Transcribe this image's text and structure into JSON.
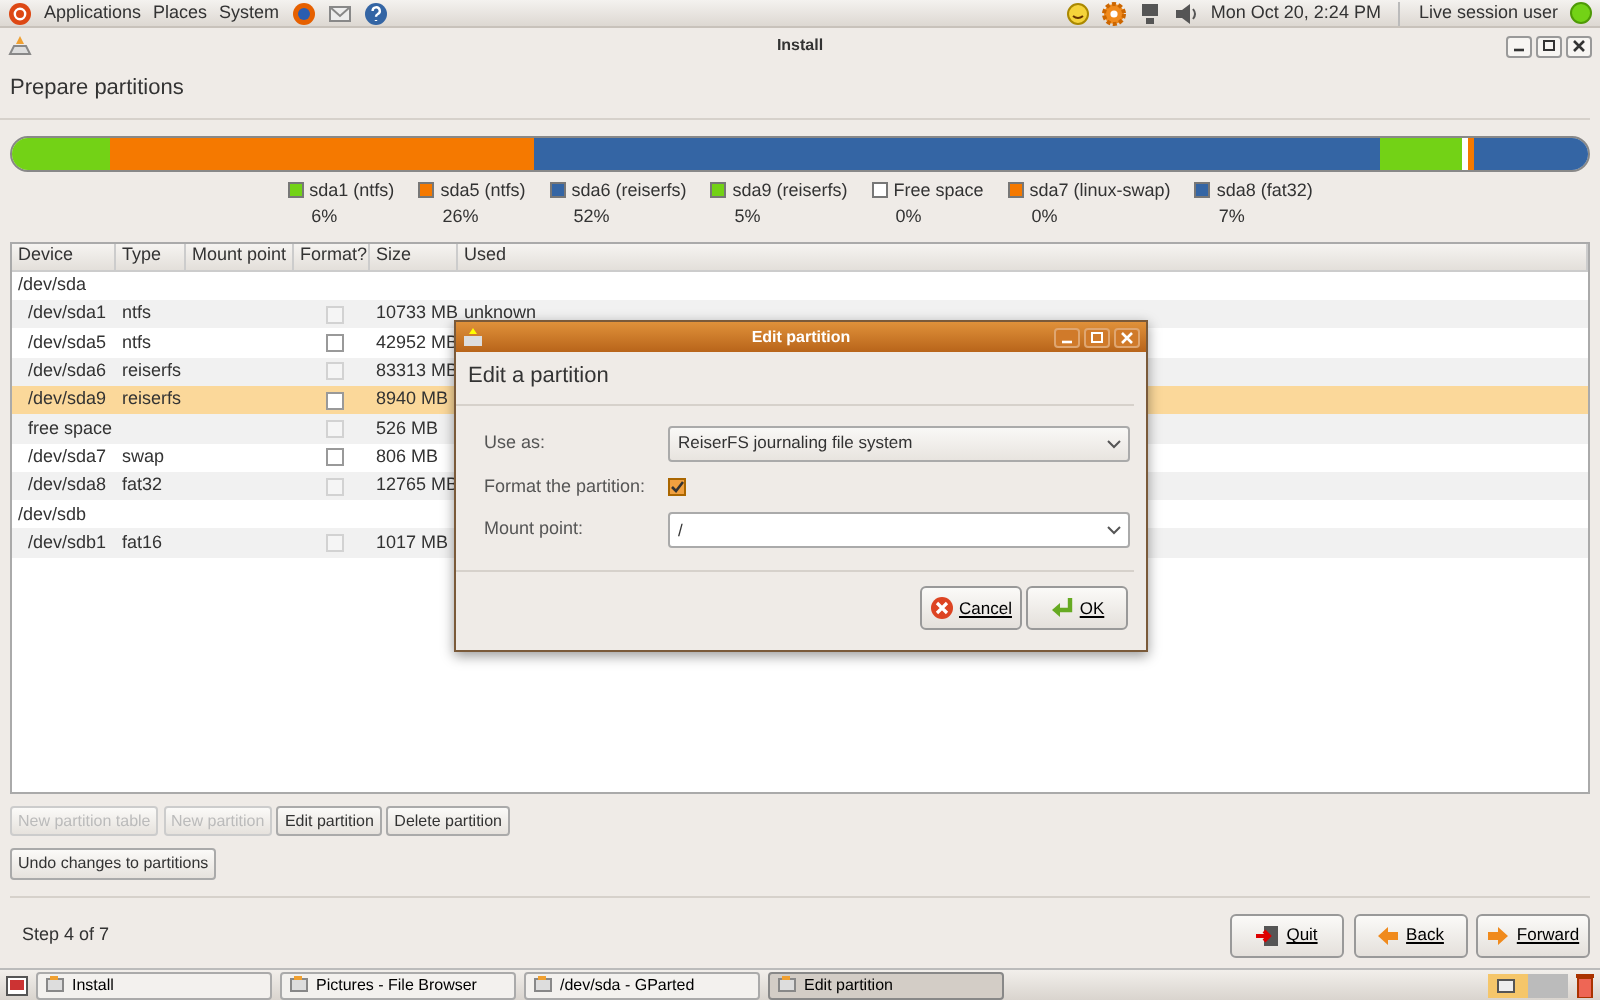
{
  "top_panel": {
    "menus": [
      "Applications",
      "Places",
      "System"
    ],
    "clock": "Mon Oct 20,  2:24 PM",
    "user": "Live session user"
  },
  "window": {
    "title": "Install"
  },
  "page": {
    "heading": "Prepare partitions"
  },
  "partitions": [
    {
      "name": "sda1 (ntfs)",
      "percent": "6%",
      "color": "#73d216"
    },
    {
      "name": "sda5 (ntfs)",
      "percent": "26%",
      "color": "#f57900"
    },
    {
      "name": "sda6 (reiserfs)",
      "percent": "52%",
      "color": "#3465a4"
    },
    {
      "name": "sda9 (reiserfs)",
      "percent": "5%",
      "color": "#73d216"
    },
    {
      "name": "Free space",
      "percent": "0%",
      "color": "#ffffff"
    },
    {
      "name": "sda7 (linux-swap)",
      "percent": "0%",
      "color": "#f57900"
    },
    {
      "name": "sda8 (fat32)",
      "percent": "7%",
      "color": "#3465a4"
    }
  ],
  "table": {
    "columns": [
      "Device",
      "Type",
      "Mount point",
      "Format?",
      "Size",
      "Used"
    ],
    "rows": [
      {
        "device": "/dev/sda",
        "selected": false,
        "children": [
          {
            "device": "/dev/sda1",
            "type": "ntfs",
            "size": "10733 MB",
            "used": "unknown",
            "format": false,
            "disabled": true,
            "selected": false
          },
          {
            "device": "/dev/sda5",
            "type": "ntfs",
            "size": "42952 MB",
            "format": false,
            "disabled": false,
            "selected": false
          },
          {
            "device": "/dev/sda6",
            "type": "reiserfs",
            "size": "83313 MB",
            "format": false,
            "disabled": true,
            "selected": false
          },
          {
            "device": "/dev/sda9",
            "type": "reiserfs",
            "size": "8940 MB",
            "format": false,
            "disabled": false,
            "selected": true
          },
          {
            "device": "free space",
            "size": "526 MB",
            "format": false,
            "disabled": true,
            "selected": false
          },
          {
            "device": "/dev/sda7",
            "type": "swap",
            "size": "806 MB",
            "format": false,
            "disabled": false,
            "selected": false
          },
          {
            "device": "/dev/sda8",
            "type": "fat32",
            "size": "12765 MB",
            "format": false,
            "disabled": true,
            "selected": false
          }
        ]
      },
      {
        "device": "/dev/sdb",
        "selected": false,
        "children": [
          {
            "device": "/dev/sdb1",
            "type": "fat16",
            "size": "1017 MB",
            "format": false,
            "disabled": true,
            "selected": false
          }
        ]
      }
    ]
  },
  "table_buttons": [
    {
      "label": "New partition table",
      "disabled": true
    },
    {
      "label": "New partition",
      "disabled": true
    },
    {
      "label": "Edit partition",
      "disabled": false
    },
    {
      "label": "Delete partition",
      "disabled": false
    },
    {
      "label": "Undo changes to partitions",
      "disabled": false
    }
  ],
  "step": "Step 4 of 7",
  "nav_buttons": [
    {
      "label": "Quit",
      "kind": "quit"
    },
    {
      "label": "Back",
      "kind": "back"
    },
    {
      "label": "Forward",
      "kind": "forward"
    }
  ],
  "dialog": {
    "title": "Edit partition",
    "heading": "Edit a partition",
    "use_as_label": "Use as:",
    "use_as_value": "ReiserFS journaling file system",
    "format_label": "Format the partition:",
    "format_checked": true,
    "mount_label": "Mount point:",
    "mount_value": "/",
    "buttons": [
      {
        "label": "Cancel",
        "kind": "cancel"
      },
      {
        "label": "OK",
        "kind": "ok"
      }
    ]
  },
  "taskbar": [
    {
      "label": "Install",
      "selected": false
    },
    {
      "label": "Pictures - File Browser",
      "selected": false
    },
    {
      "label": "/dev/sda - GParted",
      "selected": false
    },
    {
      "label": "Edit partition",
      "selected": true
    }
  ]
}
